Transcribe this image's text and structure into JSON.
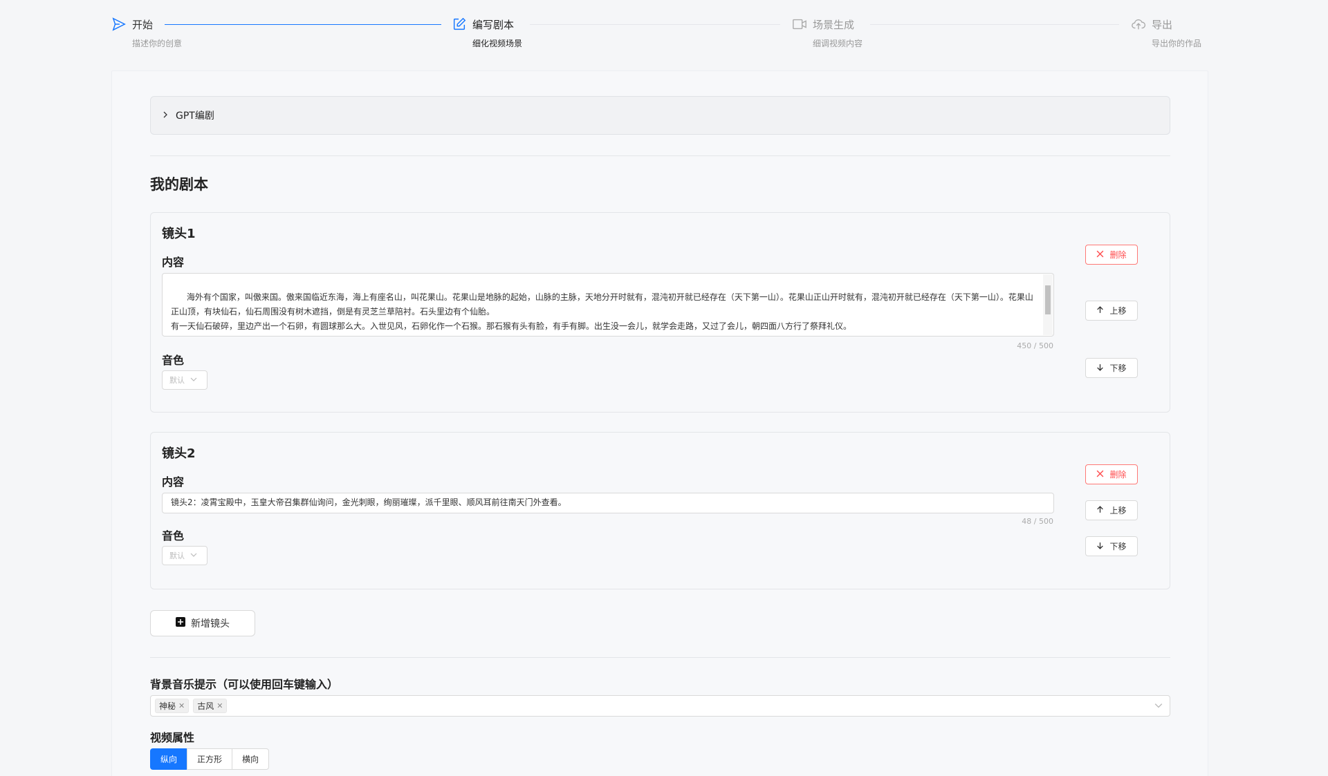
{
  "steps": [
    {
      "title": "开始",
      "desc": "描述你的创意",
      "status": "done",
      "icon": "send-icon"
    },
    {
      "title": "编写剧本",
      "desc": "细化视频场景",
      "status": "active",
      "icon": "edit-icon"
    },
    {
      "title": "场景生成",
      "desc": "细调视频内容",
      "status": "wait",
      "icon": "video-icon"
    },
    {
      "title": "导出",
      "desc": "导出你的作品",
      "status": "wait",
      "icon": "cloud-upload-icon"
    }
  ],
  "gpt_panel": {
    "label": "GPT编剧"
  },
  "script_section": {
    "title": "我的剧本"
  },
  "shots": [
    {
      "title": "镜头1",
      "content_label": "内容",
      "content": "海外有个国家，叫傲来国。傲来国临近东海，海上有座名山，叫花果山。花果山是地脉的起始，山脉的主脉，天地分开时就有，混沌初开就已经存在（天下第一山）。花果山正山开时就有，混沌初开就已经存在（天下第一山）。花果山正山顶，有块仙石，仙石周围没有树木遮挡，倒是有灵芝兰草陪衬。石头里边有个仙胎。\n有一天仙石破碎，里边产出一个石卵，有圆球那么大。入世见风，石卵化作一个石猴。那石猴有头有脸，有手有脚。出生没一会儿，就学会走路，又过了会儿，朝四面八方行了祭拜礼仪。\n拜完四方，石猴双眼金光四射，扫视苍穹，查知周围环境。金光扫过天宫，惊动了玉皇大帝，玉皇大帝召集群仙在凌霄宝殿中询问。此时殿外金光刺眼，绚此时殿外此时殿外此时殿外此时殿外此时殿外此时殿外此",
      "count": "450 / 500",
      "voice_label": "音色",
      "voice_value": "默认"
    },
    {
      "title": "镜头2",
      "content_label": "内容",
      "content": "镜头2：凌霄宝殿中，玉皇大帝召集群仙询问，金光刺眼，绚丽璀璨，派千里眼、顺风耳前往南天门外查看。",
      "count": "48 / 500",
      "voice_label": "音色",
      "voice_value": "默认"
    }
  ],
  "shot_actions": {
    "delete": "删除",
    "move_up": "上移",
    "move_down": "下移"
  },
  "add_shot_label": "新增镜头",
  "music": {
    "label": "背景音乐提示（可以使用回车键输入）",
    "tags": [
      "神秘",
      "古风"
    ]
  },
  "video": {
    "label": "视频属性",
    "options": [
      "纵向",
      "正方形",
      "横向"
    ],
    "selected": "纵向"
  },
  "colors": {
    "primary": "#1677ff",
    "danger": "#ff4d4f"
  }
}
